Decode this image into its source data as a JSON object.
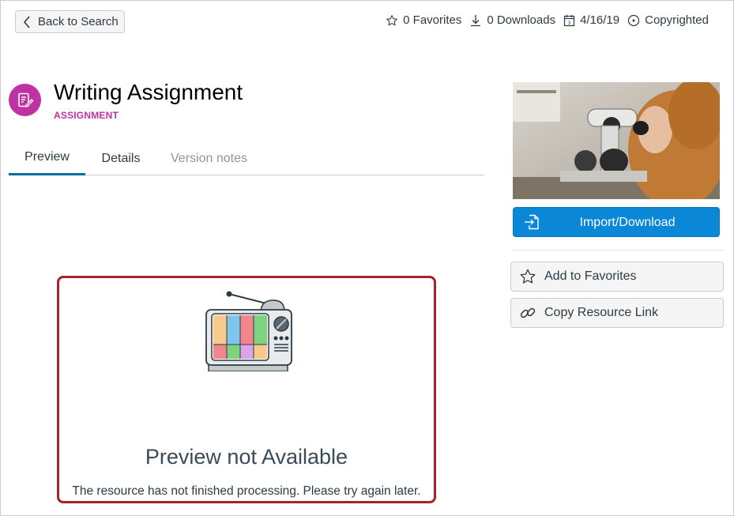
{
  "header": {
    "back_label": "Back to Search",
    "favorites": "0 Favorites",
    "downloads": "0 Downloads",
    "date": "4/16/19",
    "license": "Copyrighted"
  },
  "resource": {
    "title": "Writing Assignment",
    "type": "ASSIGNMENT"
  },
  "tabs": [
    {
      "label": "Preview",
      "active": true
    },
    {
      "label": "Details",
      "active": false
    },
    {
      "label": "Version notes",
      "active": false,
      "disabled": true
    }
  ],
  "preview": {
    "title": "Preview not Available",
    "message": "The resource has not finished processing. Please try again later."
  },
  "sidebar": {
    "import_label": "Import/Download",
    "favorite_label": "Add to Favorites",
    "copy_link_label": "Copy Resource Link"
  },
  "colors": {
    "accent": "#0b87d8",
    "assignment": "#bf32a4",
    "highlight_border": "#a0242a"
  }
}
